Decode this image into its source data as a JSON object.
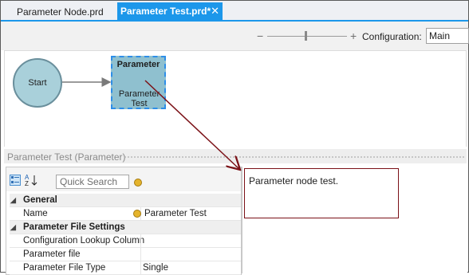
{
  "tabs": [
    {
      "label": "Parameter Node.prd",
      "active": false
    },
    {
      "label": "Parameter Test.prd*",
      "active": true
    }
  ],
  "tab_close_icon": "close-icon",
  "toolbar": {
    "zoom_minus": "−",
    "zoom_plus": "+",
    "configuration_label": "Configuration:",
    "configuration_value": "Main"
  },
  "canvas": {
    "start_node_label": "Start",
    "parameter_node_title": "Parameter",
    "parameter_node_name": "Parameter Test",
    "accent_color": "#1c97ea",
    "annotation_color": "#7b1117"
  },
  "panel": {
    "title": "Parameter Test (Parameter)"
  },
  "property_grid": {
    "search_placeholder": "Quick Search",
    "categories": [
      {
        "name": "General",
        "rows": [
          {
            "name": "Name",
            "value": "Parameter Test",
            "icon": "property-pages-icon"
          }
        ]
      },
      {
        "name": "Parameter File Settings",
        "rows": [
          {
            "name": "Configuration Lookup Column",
            "value": ""
          },
          {
            "name": "Parameter file",
            "value": ""
          },
          {
            "name": "Parameter File Type",
            "value": "Single"
          }
        ]
      }
    ]
  },
  "description": {
    "text": "Parameter node test."
  }
}
